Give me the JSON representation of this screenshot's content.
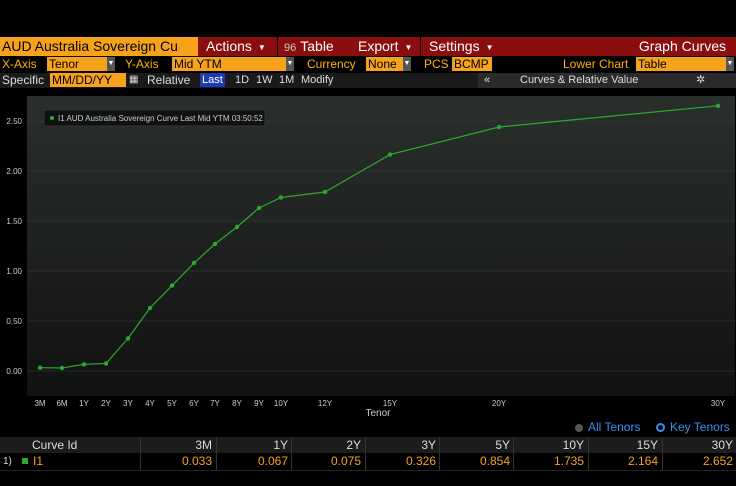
{
  "toolbar": {
    "security": "AUD Australia Sovereign Cu",
    "actions": "Actions",
    "table": "Table",
    "table_icon": "96",
    "export": "Export",
    "settings": "Settings",
    "function": "Graph Curves"
  },
  "options": {
    "xaxis_label": "X-Axis",
    "xaxis_value": "Tenor",
    "yaxis_label": "Y-Axis",
    "yaxis_value": "Mid YTM",
    "currency_label": "Currency",
    "currency_value": "None",
    "pcs_label": "PCS",
    "pcs_value": "BCMP",
    "lower_chart_label": "Lower Chart",
    "lower_chart_value": "Table"
  },
  "specific": {
    "label": "Specific",
    "date_placeholder": "MM/DD/YY",
    "relative": "Relative",
    "periods": [
      "Last",
      "1D",
      "1W",
      "1M"
    ],
    "modify": "Modify",
    "curves_toggle": "«",
    "curves_panel": "Curves & Relative Value"
  },
  "chart_data": {
    "type": "line",
    "legend": "I1 AUD Australia Sovereign Curve Last Mid YTM 03:50:52",
    "xlabel": "Tenor",
    "ylabel": "",
    "ylim": [
      -0.25,
      2.75
    ],
    "yticks": [
      "0.00",
      "0.50",
      "1.00",
      "1.50",
      "2.00",
      "2.50"
    ],
    "line_color": "#2ea82e",
    "series": [
      {
        "name": "I1",
        "points": [
          {
            "tenor": "3M",
            "value": 0.033
          },
          {
            "tenor": "6M",
            "value": 0.03
          },
          {
            "tenor": "1Y",
            "value": 0.067
          },
          {
            "tenor": "2Y",
            "value": 0.075
          },
          {
            "tenor": "3Y",
            "value": 0.326
          },
          {
            "tenor": "4Y",
            "value": 0.63
          },
          {
            "tenor": "5Y",
            "value": 0.854
          },
          {
            "tenor": "6Y",
            "value": 1.08
          },
          {
            "tenor": "7Y",
            "value": 1.27
          },
          {
            "tenor": "8Y",
            "value": 1.44
          },
          {
            "tenor": "9Y",
            "value": 1.63
          },
          {
            "tenor": "10Y",
            "value": 1.735
          },
          {
            "tenor": "12Y",
            "value": 1.79
          },
          {
            "tenor": "15Y",
            "value": 2.164
          },
          {
            "tenor": "20Y",
            "value": 2.44
          },
          {
            "tenor": "30Y",
            "value": 2.652
          }
        ]
      }
    ]
  },
  "radios": {
    "all_tenors": "All Tenors",
    "key_tenors": "Key Tenors",
    "selected": "key_tenors"
  },
  "table": {
    "headers": [
      "Curve Id",
      "3M",
      "1Y",
      "2Y",
      "3Y",
      "5Y",
      "10Y",
      "15Y",
      "30Y"
    ],
    "rows": [
      {
        "num": "1)",
        "id": "I1",
        "values": [
          "0.033",
          "0.067",
          "0.075",
          "0.326",
          "0.854",
          "1.735",
          "2.164",
          "2.652"
        ]
      }
    ]
  }
}
